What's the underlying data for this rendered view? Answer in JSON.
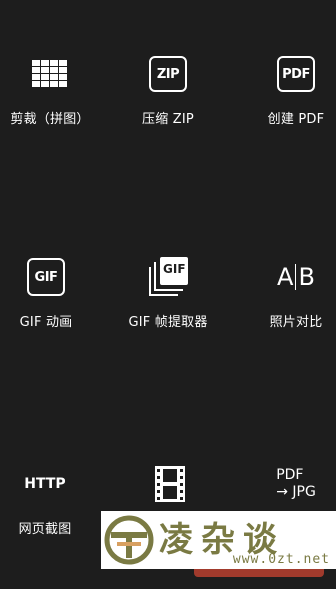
{
  "tools": {
    "crop_stitch": {
      "label": "剪裁（拼图）",
      "icon": "grid-icon"
    },
    "zip": {
      "label": "压缩 ZIP",
      "icon_text": "ZIP"
    },
    "pdf": {
      "label": "创建 PDF",
      "icon_text": "PDF"
    },
    "gif_anim": {
      "label": "GIF 动画",
      "icon_text": "GIF"
    },
    "gif_frames": {
      "label": "GIF 帧提取器",
      "icon_text": "GIF"
    },
    "compare": {
      "label": "照片对比",
      "icon_left": "A",
      "icon_right": "B"
    },
    "webpage": {
      "label": "网页截图",
      "icon_text": "HTTP"
    },
    "video": {
      "label": "",
      "icon": "film-icon"
    },
    "pdf_to_jpg": {
      "label": "",
      "icon_line1": "PDF",
      "icon_line2": "→ JPG"
    }
  },
  "watermark": {
    "text": "凌杂谈",
    "url": "www.0zt.net",
    "accent": "#7a7a43"
  }
}
